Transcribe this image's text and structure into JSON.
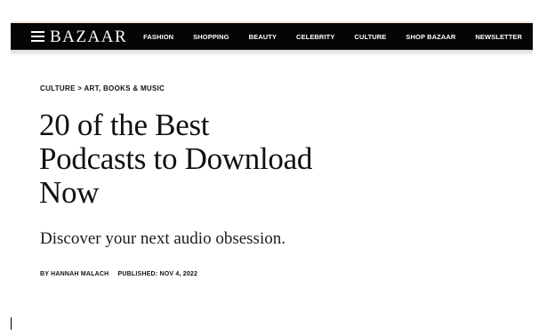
{
  "nav": {
    "logo": "BAZAAR",
    "items": [
      {
        "label": "FASHION"
      },
      {
        "label": "SHOPPING"
      },
      {
        "label": "BEAUTY"
      },
      {
        "label": "CELEBRITY"
      },
      {
        "label": "CULTURE"
      },
      {
        "label": "SHOP BAZAAR"
      },
      {
        "label": "NEWSLETTER"
      }
    ]
  },
  "article": {
    "breadcrumb": {
      "section": "CULTURE",
      "separator": ">",
      "subsection": "ART, BOOKS & MUSIC"
    },
    "title_lines": [
      "20 of the Best",
      "Podcasts to Download",
      "Now"
    ],
    "dek": "Discover your next audio obsession.",
    "byline": {
      "author": "BY HANNAH MALACH",
      "published": "PUBLISHED: NOV 4, 2022"
    }
  },
  "colors": {
    "nav_background": "#050505",
    "nav_text": "#ffffff",
    "body_text": "#111111",
    "page_background": "#ffffff"
  }
}
